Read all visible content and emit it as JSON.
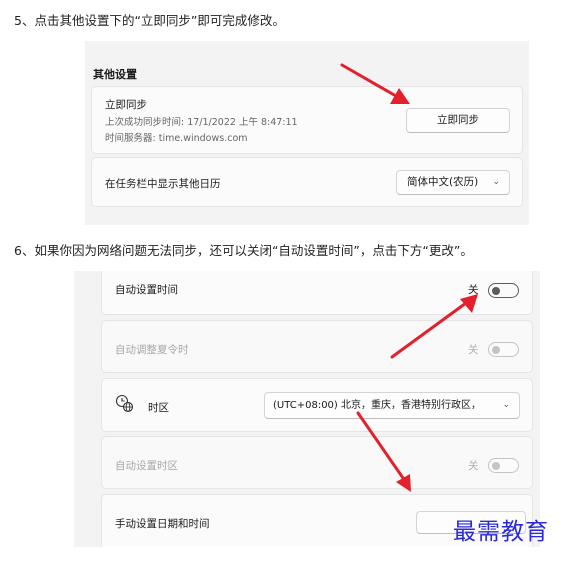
{
  "step5": "5、点击其他设置下的“立即同步”即可完成修改。",
  "step6": "6、如果你因为网络问题无法同步，还可以关闭“自动设置时间”，点击下方“更改”。",
  "other_settings": {
    "section_title": "其他设置",
    "sync_card": {
      "title": "立即同步",
      "last_sync": "上次成功同步时间: 17/1/2022 上午 8:47:11",
      "time_server": "时间服务器: time.windows.com",
      "button_label": "立即同步"
    },
    "calendar_card": {
      "title": "在任务栏中显示其他日历",
      "selected": "简体中文(农历)"
    }
  },
  "date_time_settings": {
    "auto_time": {
      "label": "自动设置时间",
      "state_text": "关",
      "enabled": true,
      "on": false
    },
    "auto_dst": {
      "label": "自动调整夏令时",
      "state_text": "关",
      "enabled": false,
      "on": false
    },
    "timezone": {
      "label": "时区",
      "selected": "(UTC+08:00) 北京，重庆，香港特别行政区，"
    },
    "auto_timezone": {
      "label": "自动设置时区",
      "state_text": "关",
      "enabled": false,
      "on": false
    },
    "manual": {
      "label": "手动设置日期和时间"
    }
  },
  "watermark": "最需教育",
  "colors": {
    "arrow": "#e3202c",
    "watermark": "#2a2ad8"
  }
}
